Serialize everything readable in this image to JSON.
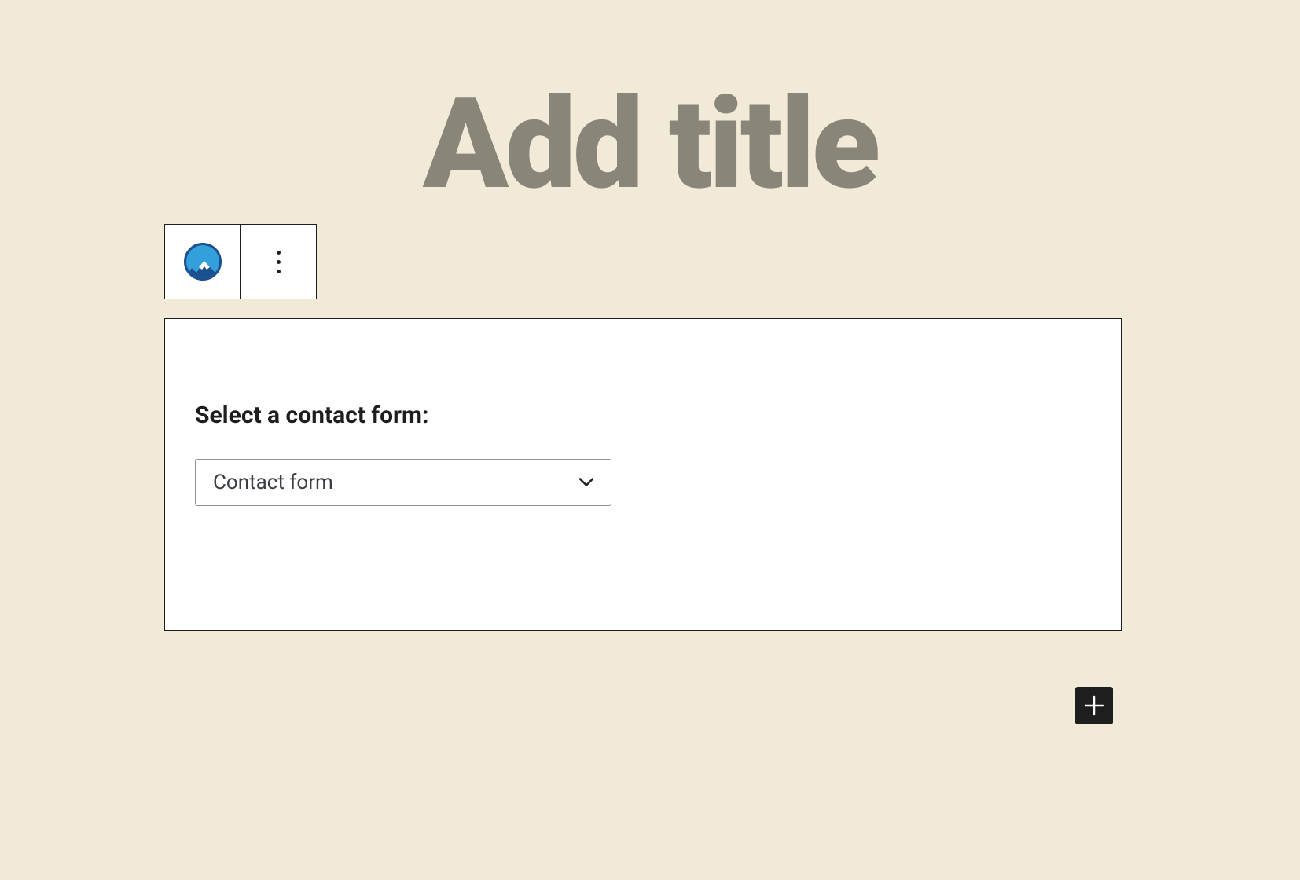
{
  "editor": {
    "title_placeholder": "Add title"
  },
  "block": {
    "label": "Select a contact form:",
    "select": {
      "selected": "Contact form",
      "options": [
        "Contact form"
      ]
    }
  },
  "icons": {
    "block_type": "mountain-logo-icon",
    "more": "more-vertical-icon",
    "chevron": "chevron-down-icon",
    "add": "plus-icon"
  }
}
